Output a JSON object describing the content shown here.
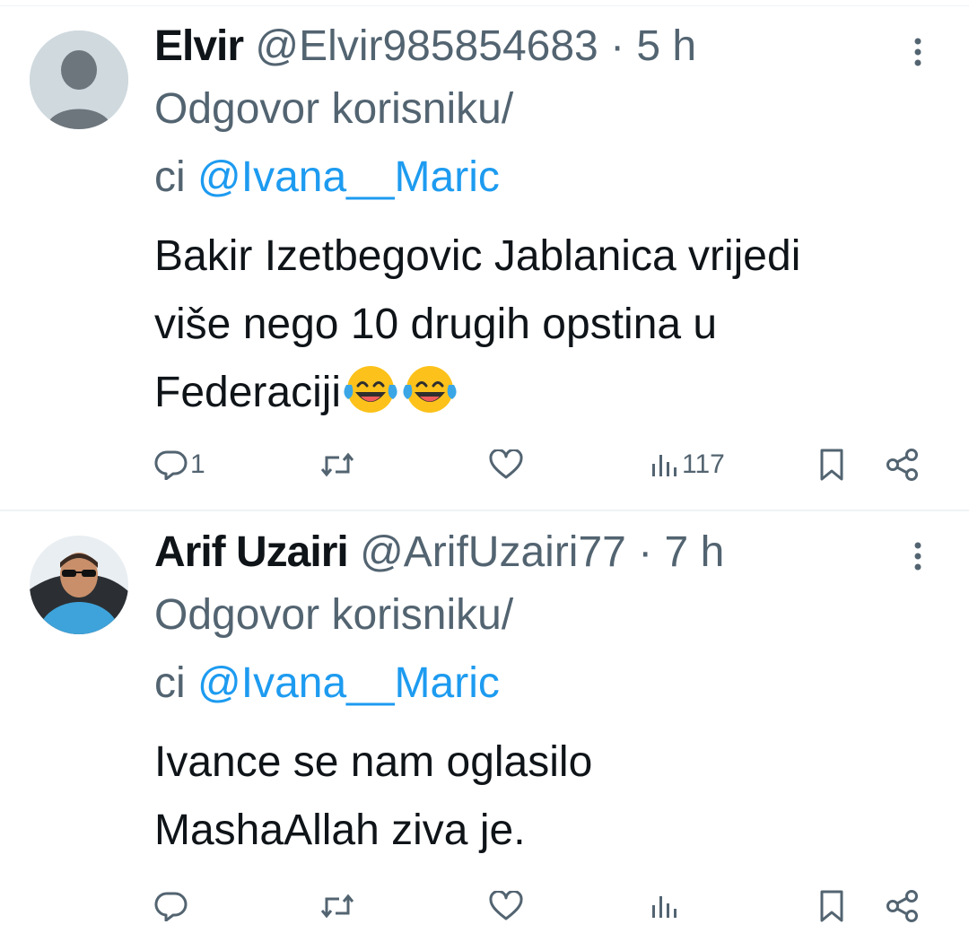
{
  "tweets": [
    {
      "name": "Elvir",
      "handle": "@Elvir985854683",
      "separator": "·",
      "time": "5 h",
      "reply_prefix_line1": "Odgovor korisniku/",
      "reply_prefix_line2": "ci",
      "reply_mention": "@Ivana__Maric",
      "text_line1": "Bakir Izetbegovic Jablanica vrijedi",
      "text_line2": "više nego 10 drugih opstina u",
      "text_line3": "Federaciji",
      "emoji": [
        "face-with-tears-of-joy",
        "face-with-tears-of-joy"
      ],
      "replies": "1",
      "views": "117"
    },
    {
      "name": "Arif Uzairi",
      "handle": "@ArifUzairi77",
      "separator": "·",
      "time": "7 h",
      "reply_prefix_line1": "Odgovor korisniku/",
      "reply_prefix_line2": "ci",
      "reply_mention": "@Ivana__Maric",
      "text_line1": "Ivance se nam oglasilo",
      "text_line2": "MashaAllah ziva je."
    }
  ],
  "colors": {
    "text": "#0f1419",
    "secondary": "#536471",
    "link": "#1d9bf0",
    "divider": "#eff3f4"
  }
}
